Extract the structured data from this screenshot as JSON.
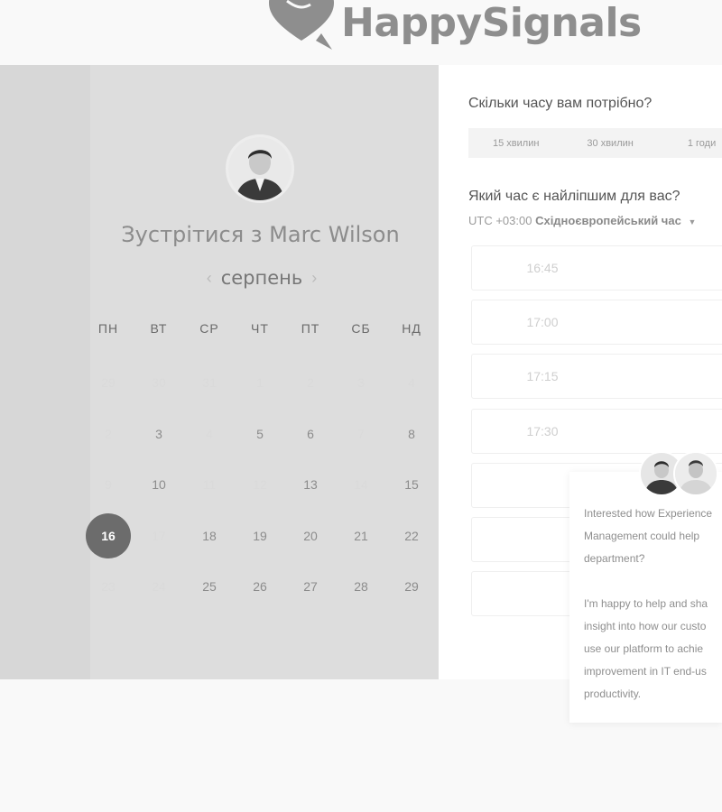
{
  "header": {
    "brand": "HappySignals"
  },
  "booking": {
    "title": "Зустрітися з Marc Wilson",
    "month": "серпень",
    "weekdays": [
      "ПН",
      "ВТ",
      "СР",
      "ЧТ",
      "ПТ",
      "СБ",
      "НД"
    ],
    "days": [
      [
        "29",
        "30",
        "31",
        "1",
        "2",
        "3",
        "4"
      ],
      [
        "2",
        "3",
        "4",
        "5",
        "6",
        "7",
        "8"
      ],
      [
        "9",
        "10",
        "11",
        "12",
        "13",
        "14",
        "15"
      ],
      [
        "16",
        "17",
        "18",
        "19",
        "20",
        "21",
        "22"
      ],
      [
        "23",
        "24",
        "25",
        "26",
        "27",
        "28",
        "29"
      ]
    ],
    "available_dates": [
      "3",
      "5",
      "6",
      "8",
      "10",
      "13",
      "15",
      "18",
      "19",
      "20",
      "21",
      "22",
      "25",
      "26",
      "27",
      "28",
      "29"
    ],
    "selected_date": "16"
  },
  "duration": {
    "question": "Скільки часу вам потрібно?",
    "options": [
      "15 хвилин",
      "30 хвилин",
      "1 годи"
    ]
  },
  "time": {
    "question": "Який час є найліпшим для вас?",
    "timezone_offset": "UTC +03:00",
    "timezone_name": "Східноєвропейський час",
    "slots": [
      "16:45",
      "17:00",
      "17:15",
      "17:30",
      "",
      "",
      ""
    ]
  },
  "chat": {
    "lines": [
      "Interested how Experience",
      "Management could help",
      "department?",
      "",
      "I'm happy to help and sha",
      "insight into how our custo",
      "use our platform to achie",
      "improvement in IT end-us",
      "productivity."
    ]
  },
  "colors": {
    "left_panel": "#dddddd",
    "selected_day": "#6c6c6c",
    "logo": "#8e8e8e",
    "page_bg": "#f9f9f9"
  }
}
